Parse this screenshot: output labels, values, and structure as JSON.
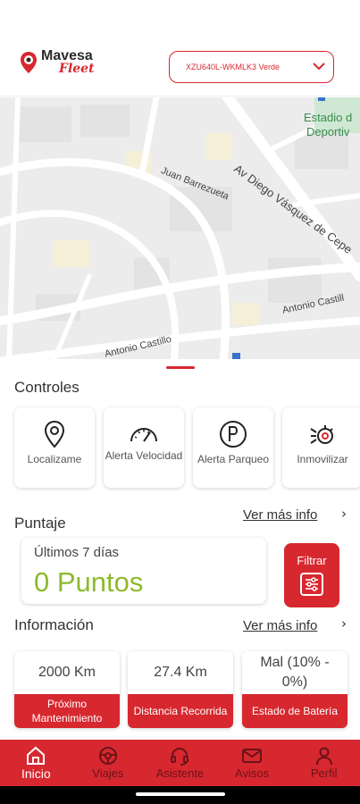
{
  "app": {
    "brand_main": "Mavesa",
    "brand_sub": "Fleet",
    "vehicle_selector": "XZU640L-WKMLK3 Verde",
    "accent_color": "#d7282f",
    "score_color": "#8dba2c"
  },
  "map": {
    "labels": [
      "Av Diego Vásquez de Cepe",
      "Estadio d",
      "Deportiv",
      "Juan Barrezueta",
      "Antonio Castillo",
      "Antonio Castill"
    ]
  },
  "controls": {
    "title": "Controles",
    "items": [
      {
        "label": "Localizame",
        "icon": "location-pin-icon"
      },
      {
        "label": "Alerta Velocidad",
        "icon": "speedometer-icon"
      },
      {
        "label": "Alerta Parqueo",
        "icon": "parking-icon"
      },
      {
        "label": "Inmovilizar",
        "icon": "engine-immobilize-icon"
      }
    ]
  },
  "score": {
    "title": "Puntaje",
    "more": "Ver más info",
    "period": "Últimos 7 días",
    "value": "0 Puntos",
    "filter_label": "Filtrar"
  },
  "info": {
    "title": "Información",
    "more": "Ver más info",
    "cards": [
      {
        "value": "2000 Km",
        "label": "Próximo Mantenimiento"
      },
      {
        "value": "27.4 Km",
        "label": "Distancia Recorrida"
      },
      {
        "value": "Mal (10% - 0%)",
        "label": "Estado de Batería"
      }
    ]
  },
  "nav": {
    "items": [
      {
        "label": "Inicio",
        "icon": "home-icon",
        "active": true
      },
      {
        "label": "Viajes",
        "icon": "steering-wheel-icon",
        "active": false
      },
      {
        "label": "Asistente",
        "icon": "headset-icon",
        "active": false
      },
      {
        "label": "Avisos",
        "icon": "mail-icon",
        "active": false
      },
      {
        "label": "Perfil",
        "icon": "user-icon",
        "active": false
      }
    ]
  }
}
